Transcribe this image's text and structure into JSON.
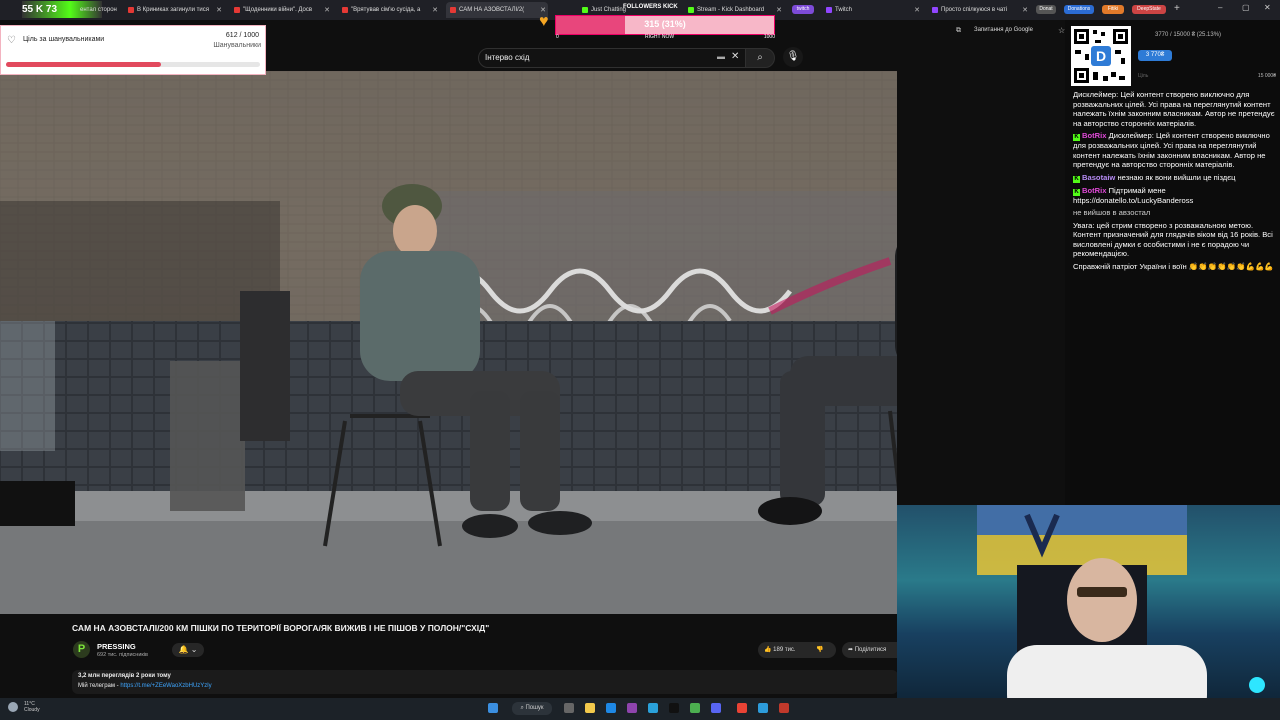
{
  "browser": {
    "kick_badge": "55 K 73",
    "tabs": [
      {
        "label": "ентал сторон"
      },
      {
        "label": "В Криниках загинули тися"
      },
      {
        "label": "\"Щоденники війни\". Досв"
      },
      {
        "label": "\"Врятував сім'ю сусіда, а"
      },
      {
        "label": "САМ НА АЗОВСТАЛІ/2("
      },
      {
        "label": "Just Chatting"
      },
      {
        "label": "Stream - Kick Dashboard"
      },
      {
        "label": "Twitch"
      },
      {
        "label": "Просто спілкуюся в чаті"
      }
    ],
    "pills": [
      "twitch",
      "Donat",
      "Donations",
      "Fitiki",
      "DeepState"
    ],
    "toolbar": {
      "translate_label": "Запитання до Google"
    },
    "search": {
      "value": "Інтерво схід"
    }
  },
  "goal_widget": {
    "title": "Ціль за шанувальниками",
    "count": "612 / 1000",
    "subtitle": "Шанувальники",
    "progress": 0.612
  },
  "followers_widget": {
    "title": "FOLLOWERS KICK",
    "value": "315 (31%)",
    "min": "0",
    "center": "RIGHT NOW",
    "max": "1000",
    "progress": 0.315
  },
  "video": {
    "title": "САМ НА АЗОВСТАЛІ/200 КМ ПІШКИ ПО ТЕРИТОРІЇ ВОРОГА/ЯК ВИЖИВ І НЕ ПІШОВ У ПОЛОН/\"СХІД\"",
    "channel_name": "PRESSING",
    "subscribers": "692 тис. підписників",
    "likes": "189 тис.",
    "share_label": "Поділитися",
    "views": "3,2 млн переглядів  2 роки тому",
    "telegram_label": "Мій телеграм - ",
    "telegram_link": "https://t.me/+ZEeWaoXzbHUzYzly"
  },
  "chat": {
    "donation_progress": "3770 / 15000 ₴ (25.13%)",
    "donation_amount": "3 770₴",
    "goal_caption": "Ціль",
    "goal_max": "15 000₴",
    "messages": [
      {
        "user": "",
        "text": "Дисклеймер: Цей контент створено виключно для розважальних цілей. Усі права на переглянутий контент належать їхнім законним власникам. Автор не претендує на авторство сторонніх матеріалів."
      },
      {
        "user": "BotRix",
        "text": "Дисклеймер: Цей контент створено виключно для розважальних цілей. Усі права на переглянутий контент належать їхнім законним власникам. Автор не претендує на авторство сторонніх матеріалів."
      },
      {
        "user": "Basotaiw",
        "text": "незнаю як вони вийшли це піздєц"
      },
      {
        "user": "BotRix",
        "text": "Підтримай мене https://donatello.to/LuckyBandeross"
      },
      {
        "user": "",
        "text": "не вийшов в авзостал"
      },
      {
        "user": "",
        "text": "Увага: цей стрим створено з розважальною метою. Контент призначений для глядачів віком від 16 років. Всі висловлені думки є особистими і не є порадою чи рекомендацією."
      },
      {
        "user": "",
        "text": "Справжній патріот України і воїн 👏👏👏👏👏👏💪💪💪"
      }
    ]
  },
  "taskbar": {
    "weather_temp": "11°C",
    "weather_desc": "Cloudy",
    "search_label": "Пошук"
  },
  "colors": {
    "accent_kick": "#53fc18",
    "youtube_bg": "#0f0f0f",
    "goal_fill": "#e2495d"
  }
}
